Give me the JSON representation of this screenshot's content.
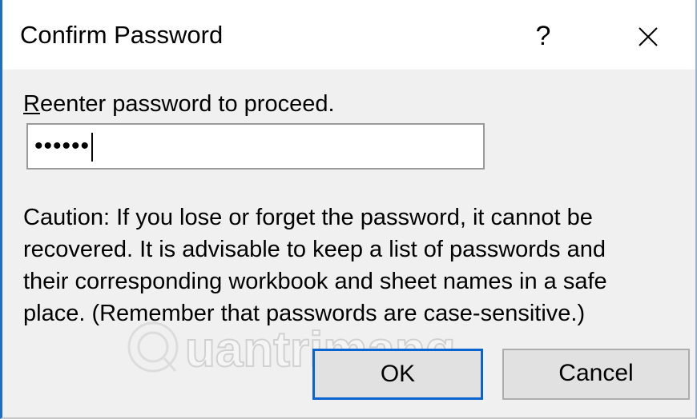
{
  "window": {
    "title": "Confirm Password",
    "help_glyph": "?",
    "close_icon": "close-icon"
  },
  "prompt": {
    "text_underlined": "R",
    "text_rest": "eenter password to proceed."
  },
  "password_field": {
    "value": "••••••"
  },
  "caution": {
    "lines": [
      "Caution: If you lose or forget the password, it cannot be",
      "recovered. It is advisable to keep a list of passwords and",
      "their corresponding workbook and sheet names in a safe",
      "place.  (Remember that passwords are case-sensitive.)"
    ]
  },
  "buttons": {
    "ok_label": "OK",
    "cancel_label": "Cancel"
  },
  "watermark": {
    "text": "uantrimang",
    "logo": "quantrimang-logo"
  },
  "colors": {
    "accent_border": "#1f6fc4",
    "ok_focus_border": "#0a64cf",
    "button_face": "#e1e1e1",
    "dialog_background": "#f0f0f0"
  }
}
